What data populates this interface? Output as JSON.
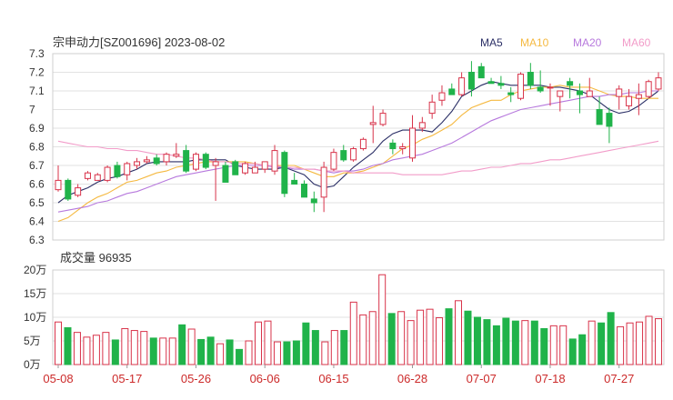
{
  "title": "宗申动力[SZ001696] 2023-08-02",
  "legend": [
    {
      "name": "MA5",
      "color": "#2b2f66"
    },
    {
      "name": "MA10",
      "color": "#f5b941"
    },
    {
      "name": "MA20",
      "color": "#b779dd"
    },
    {
      "name": "MA60",
      "color": "#f29cc9"
    }
  ],
  "colors": {
    "up": "#d8334a",
    "down": "#20b34a",
    "grid": "#e2e2e2"
  },
  "chart_data": {
    "type": "candlestick",
    "dates": [
      "05-08",
      "05-09",
      "05-10",
      "05-11",
      "05-12",
      "05-15",
      "05-16",
      "05-17",
      "05-18",
      "05-19",
      "05-22",
      "05-23",
      "05-24",
      "05-25",
      "05-26",
      "05-29",
      "05-30",
      "05-31",
      "06-01",
      "06-02",
      "06-05",
      "06-06",
      "06-07",
      "06-08",
      "06-09",
      "06-12",
      "06-13",
      "06-14",
      "06-15",
      "06-16",
      "06-19",
      "06-20",
      "06-21",
      "06-23",
      "06-26",
      "06-27",
      "06-28",
      "06-29",
      "06-30",
      "07-03",
      "07-04",
      "07-05",
      "07-06",
      "07-07",
      "07-10",
      "07-11",
      "07-12",
      "07-13",
      "07-14",
      "07-17",
      "07-18",
      "07-19",
      "07-20",
      "07-21",
      "07-24",
      "07-25",
      "07-26",
      "07-27",
      "07-28",
      "07-31",
      "08-01",
      "08-02"
    ],
    "x_tick_labels": [
      "05-08",
      "05-17",
      "05-26",
      "06-06",
      "06-15",
      "06-28",
      "07-07",
      "07-18",
      "07-27"
    ],
    "price": {
      "ylim": [
        6.3,
        7.3
      ],
      "yticks": [
        "7.3",
        "7.2",
        "7.1",
        "7",
        "6.9",
        "6.8",
        "6.7",
        "6.6",
        "6.5",
        "6.4",
        "6.3"
      ],
      "ohlc": [
        [
          6.57,
          6.7,
          6.56,
          6.62
        ],
        [
          6.62,
          6.63,
          6.51,
          6.52
        ],
        [
          6.54,
          6.6,
          6.53,
          6.58
        ],
        [
          6.63,
          6.67,
          6.62,
          6.66
        ],
        [
          6.62,
          6.66,
          6.62,
          6.65
        ],
        [
          6.62,
          6.7,
          6.61,
          6.69
        ],
        [
          6.7,
          6.72,
          6.63,
          6.64
        ],
        [
          6.65,
          6.72,
          6.62,
          6.71
        ],
        [
          6.7,
          6.74,
          6.68,
          6.72
        ],
        [
          6.72,
          6.75,
          6.71,
          6.73
        ],
        [
          6.74,
          6.76,
          6.7,
          6.71
        ],
        [
          6.72,
          6.77,
          6.7,
          6.76
        ],
        [
          6.75,
          6.82,
          6.74,
          6.76
        ],
        [
          6.78,
          6.81,
          6.66,
          6.67
        ],
        [
          6.68,
          6.77,
          6.67,
          6.76
        ],
        [
          6.76,
          6.77,
          6.68,
          6.69
        ],
        [
          6.7,
          6.74,
          6.51,
          6.72
        ],
        [
          6.7,
          6.72,
          6.61,
          6.61
        ],
        [
          6.72,
          6.73,
          6.65,
          6.65
        ],
        [
          6.66,
          6.72,
          6.65,
          6.71
        ],
        [
          6.66,
          6.72,
          6.66,
          6.69
        ],
        [
          6.68,
          6.72,
          6.66,
          6.72
        ],
        [
          6.67,
          6.81,
          6.65,
          6.78
        ],
        [
          6.77,
          6.78,
          6.53,
          6.55
        ],
        [
          6.62,
          6.66,
          6.6,
          6.6
        ],
        [
          6.6,
          6.62,
          6.53,
          6.53
        ],
        [
          6.52,
          6.56,
          6.45,
          6.5
        ],
        [
          6.53,
          6.72,
          6.45,
          6.69
        ],
        [
          6.68,
          6.79,
          6.67,
          6.77
        ],
        [
          6.78,
          6.81,
          6.72,
          6.73
        ],
        [
          6.73,
          6.8,
          6.72,
          6.79
        ],
        [
          6.79,
          6.85,
          6.78,
          6.84
        ],
        [
          6.92,
          7.02,
          6.82,
          6.93
        ],
        [
          6.92,
          7.0,
          6.91,
          6.98
        ],
        [
          6.82,
          6.84,
          6.76,
          6.79
        ],
        [
          6.79,
          6.82,
          6.76,
          6.8
        ],
        [
          6.74,
          6.97,
          6.72,
          6.9
        ],
        [
          6.9,
          6.96,
          6.88,
          6.93
        ],
        [
          6.98,
          7.08,
          6.95,
          7.04
        ],
        [
          7.05,
          7.13,
          7.02,
          7.09
        ],
        [
          7.11,
          7.14,
          7.08,
          7.08
        ],
        [
          7.08,
          7.2,
          7.07,
          7.17
        ],
        [
          7.2,
          7.26,
          7.07,
          7.11
        ],
        [
          7.23,
          7.25,
          7.17,
          7.17
        ],
        [
          7.15,
          7.17,
          7.14,
          7.14
        ],
        [
          7.14,
          7.18,
          7.11,
          7.13
        ],
        [
          7.09,
          7.12,
          7.04,
          7.08
        ],
        [
          7.06,
          7.2,
          7.05,
          7.19
        ],
        [
          7.2,
          7.25,
          7.11,
          7.13
        ],
        [
          7.12,
          7.21,
          7.09,
          7.1
        ],
        [
          7.12,
          7.14,
          7.02,
          7.12
        ],
        [
          7.07,
          7.1,
          6.99,
          7.1
        ],
        [
          7.15,
          7.17,
          7.06,
          7.13
        ],
        [
          7.1,
          7.14,
          6.98,
          7.08
        ],
        [
          7.07,
          7.17,
          7.07,
          7.1
        ],
        [
          7.0,
          7.07,
          6.98,
          6.92
        ],
        [
          6.98,
          7.01,
          6.82,
          6.91
        ],
        [
          7.07,
          7.13,
          7.0,
          7.11
        ],
        [
          7.02,
          7.11,
          7.0,
          7.07
        ],
        [
          7.06,
          7.14,
          6.97,
          7.08
        ],
        [
          7.07,
          7.16,
          7.06,
          7.15
        ],
        [
          7.11,
          7.2,
          7.1,
          7.17
        ]
      ],
      "ma": {
        "MA5": [
          6.5,
          6.54,
          6.56,
          6.58,
          6.61,
          6.63,
          6.64,
          6.66,
          6.68,
          6.71,
          6.72,
          6.72,
          6.72,
          6.72,
          6.73,
          6.73,
          6.73,
          6.73,
          6.7,
          6.69,
          6.68,
          6.68,
          6.68,
          6.69,
          6.67,
          6.65,
          6.6,
          6.58,
          6.59,
          6.64,
          6.69,
          6.73,
          6.77,
          6.83,
          6.87,
          6.89,
          6.89,
          6.89,
          6.88,
          6.93,
          6.99,
          7.07,
          7.1,
          7.13,
          7.15,
          7.14,
          7.13,
          7.13,
          7.13,
          7.13,
          7.12,
          7.12,
          7.11,
          7.1,
          7.08,
          7.04,
          7.0,
          6.98,
          6.99,
          7.02,
          7.06,
          7.1
        ],
        "MA10": [
          6.4,
          6.42,
          6.46,
          6.5,
          6.53,
          6.55,
          6.58,
          6.61,
          6.62,
          6.64,
          6.66,
          6.67,
          6.69,
          6.7,
          6.71,
          6.72,
          6.72,
          6.72,
          6.72,
          6.72,
          6.71,
          6.7,
          6.7,
          6.7,
          6.7,
          6.68,
          6.66,
          6.64,
          6.64,
          6.66,
          6.66,
          6.67,
          6.69,
          6.71,
          6.75,
          6.79,
          6.81,
          6.84,
          6.86,
          6.89,
          6.92,
          6.97,
          7.01,
          7.03,
          7.05,
          7.05,
          7.08,
          7.1,
          7.11,
          7.12,
          7.12,
          7.13,
          7.12,
          7.12,
          7.12,
          7.1,
          7.08,
          7.07,
          7.07,
          7.06,
          7.06,
          7.06
        ],
        "MA20": [
          6.45,
          6.46,
          6.47,
          6.48,
          6.5,
          6.51,
          6.53,
          6.55,
          6.56,
          6.58,
          6.6,
          6.62,
          6.64,
          6.65,
          6.66,
          6.67,
          6.68,
          6.69,
          6.7,
          6.7,
          6.7,
          6.7,
          6.69,
          6.69,
          6.68,
          6.68,
          6.68,
          6.67,
          6.66,
          6.67,
          6.67,
          6.68,
          6.7,
          6.71,
          6.73,
          6.74,
          6.75,
          6.76,
          6.78,
          6.8,
          6.82,
          6.85,
          6.88,
          6.91,
          6.94,
          6.96,
          6.98,
          7.0,
          7.01,
          7.02,
          7.03,
          7.04,
          7.05,
          7.06,
          7.07,
          7.07,
          7.08,
          7.08,
          7.09,
          7.09,
          7.1,
          7.1
        ],
        "MA60": [
          6.83,
          6.82,
          6.81,
          6.8,
          6.8,
          6.79,
          6.79,
          6.78,
          6.78,
          6.77,
          6.76,
          6.76,
          6.75,
          6.74,
          6.74,
          6.73,
          6.72,
          6.72,
          6.71,
          6.71,
          6.71,
          6.7,
          6.7,
          6.69,
          6.69,
          6.68,
          6.68,
          6.67,
          6.67,
          6.67,
          6.66,
          6.66,
          6.66,
          6.66,
          6.66,
          6.65,
          6.65,
          6.65,
          6.65,
          6.65,
          6.66,
          6.67,
          6.67,
          6.68,
          6.69,
          6.69,
          6.7,
          6.71,
          6.71,
          6.72,
          6.73,
          6.73,
          6.74,
          6.75,
          6.76,
          6.77,
          6.78,
          6.79,
          6.8,
          6.81,
          6.82,
          6.83
        ]
      }
    },
    "volume": {
      "label": "成交量 96935",
      "ylim": [
        0,
        200000
      ],
      "yticks": [
        "20万",
        "15万",
        "10万",
        "5万",
        "0万"
      ],
      "values": [
        90000,
        78000,
        68000,
        58000,
        62000,
        68000,
        52000,
        76000,
        72000,
        70000,
        56000,
        56000,
        56000,
        84000,
        75000,
        53000,
        58000,
        44000,
        52000,
        32000,
        50000,
        90000,
        92000,
        48000,
        48000,
        50000,
        88000,
        72000,
        48000,
        72000,
        72000,
        132000,
        105000,
        112000,
        190000,
        108000,
        112000,
        93000,
        115000,
        117000,
        99000,
        118000,
        135000,
        113000,
        100000,
        95000,
        82000,
        98000,
        92000,
        93000,
        92000,
        76000,
        82000,
        82000,
        54000,
        63000,
        92000,
        88000,
        110000,
        80000,
        88000,
        90000,
        102000,
        97000
      ]
    }
  }
}
